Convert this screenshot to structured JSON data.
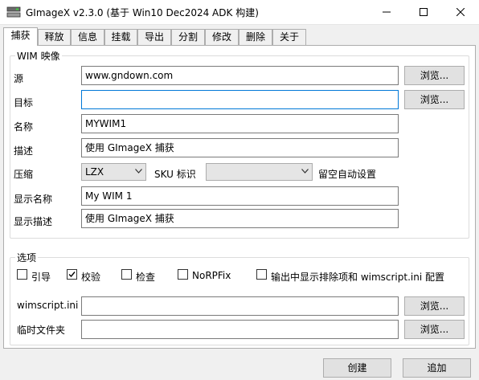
{
  "window": {
    "title": "GImageX v2.3.0 (基于 Win10 Dec2024 ADK 构建)",
    "icon": "app-icon"
  },
  "tabs": [
    {
      "label": "捕获",
      "active": true
    },
    {
      "label": "释放",
      "active": false
    },
    {
      "label": "信息",
      "active": false
    },
    {
      "label": "挂载",
      "active": false
    },
    {
      "label": "导出",
      "active": false
    },
    {
      "label": "分割",
      "active": false
    },
    {
      "label": "修改",
      "active": false
    },
    {
      "label": "删除",
      "active": false
    },
    {
      "label": "关于",
      "active": false
    }
  ],
  "wim": {
    "group_title": "WIM 映像",
    "source_label": "源",
    "source_value": "www.gndown.com",
    "target_label": "目标",
    "target_value": "",
    "name_label": "名称",
    "name_value": "MYWIM1",
    "desc_label": "描述",
    "desc_value": "使用 GImageX 捕获",
    "compress_label": "压缩",
    "compress_value": "LZX",
    "sku_label": "SKU 标识",
    "sku_value": "",
    "sku_note": "留空自动设置",
    "display_name_label": "显示名称",
    "display_name_value": "My WIM 1",
    "display_desc_label": "显示描述",
    "display_desc_value": "使用 GImageX 捕获",
    "browse_label": "浏览..."
  },
  "options": {
    "group_title": "选项",
    "checkboxes": [
      {
        "label": "引导",
        "checked": false
      },
      {
        "label": "校验",
        "checked": true
      },
      {
        "label": "检查",
        "checked": false
      },
      {
        "label": "NoRPFix",
        "checked": false
      },
      {
        "label": "输出中显示排除项和 wimscript.ini 配置",
        "checked": false
      }
    ],
    "wimscript_label": "wimscript.ini",
    "wimscript_value": "",
    "temp_label": "临时文件夹",
    "temp_value": "",
    "browse_label": "浏览..."
  },
  "footer": {
    "create_label": "创建",
    "append_label": "追加"
  }
}
